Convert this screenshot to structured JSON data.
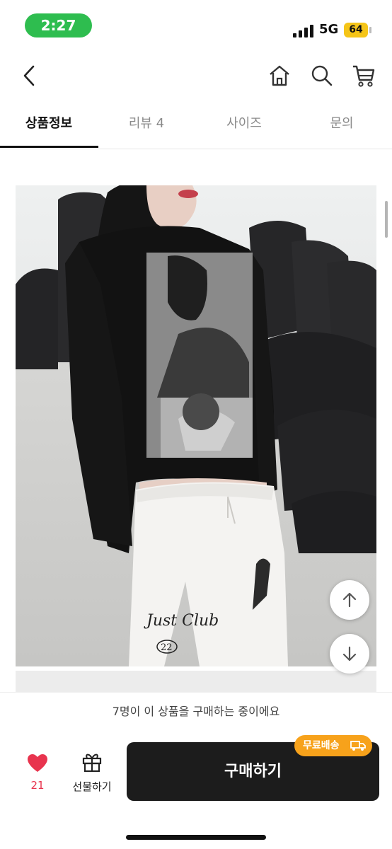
{
  "status_bar": {
    "time": "2:27",
    "network": "5G",
    "battery": "64"
  },
  "tabs": [
    {
      "label": "상품정보",
      "active": true
    },
    {
      "label": "리뷰 4",
      "active": false
    },
    {
      "label": "사이즈",
      "active": false
    },
    {
      "label": "문의",
      "active": false
    }
  ],
  "product_image": {
    "print_text": "Just Club",
    "print_number": "22"
  },
  "notice": {
    "text": "7명이 이 상품을 구매하는 중이에요"
  },
  "bottom_bar": {
    "like_count": "21",
    "gift_label": "선물하기",
    "buy_label": "구매하기",
    "badge_label": "무료배송"
  },
  "colors": {
    "accent_red": "#e8344e",
    "badge_orange": "#f7a21b",
    "status_green": "#2ebd4f",
    "button_dark": "#1c1c1c"
  }
}
